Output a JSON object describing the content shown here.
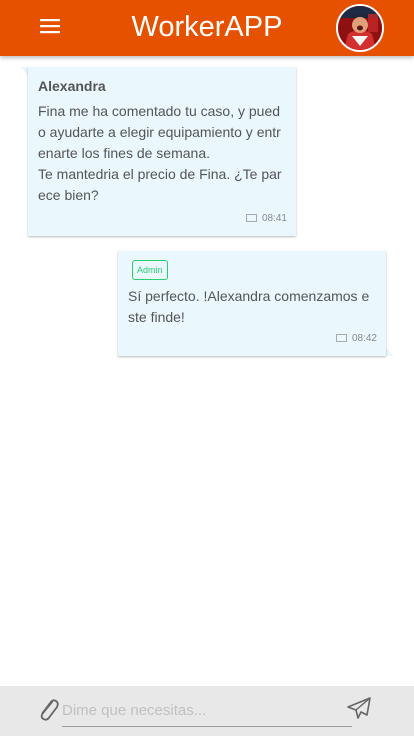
{
  "app": {
    "title": "WorkerAPP",
    "accent": "#e65100",
    "bubble_bg": "#eaf7fd",
    "admin_badge_color": "#2ecc71"
  },
  "header": {
    "menu_icon": "hamburger-menu-icon",
    "avatar_icon": "user-avatar"
  },
  "messages": [
    {
      "sender": "Alexandra",
      "text": "Fina me ha comentado tu caso, y puedo ayudarte a elegir equipamiento y entrenarte los fines de semana.\nTe mantedria el precio de Fina. ¿Te parece bien?",
      "time": "08:41",
      "icon": "chat-bubble-icon"
    },
    {
      "badge": "Admin",
      "text": "Sí perfecto. !Alexandra comenzamos este finde!",
      "time": "08:42",
      "icon": "chat-bubble-icon"
    }
  ],
  "composer": {
    "placeholder": "Dime que necesitas...",
    "value": "",
    "attach_icon": "paperclip-icon",
    "send_icon": "paper-plane-icon"
  }
}
